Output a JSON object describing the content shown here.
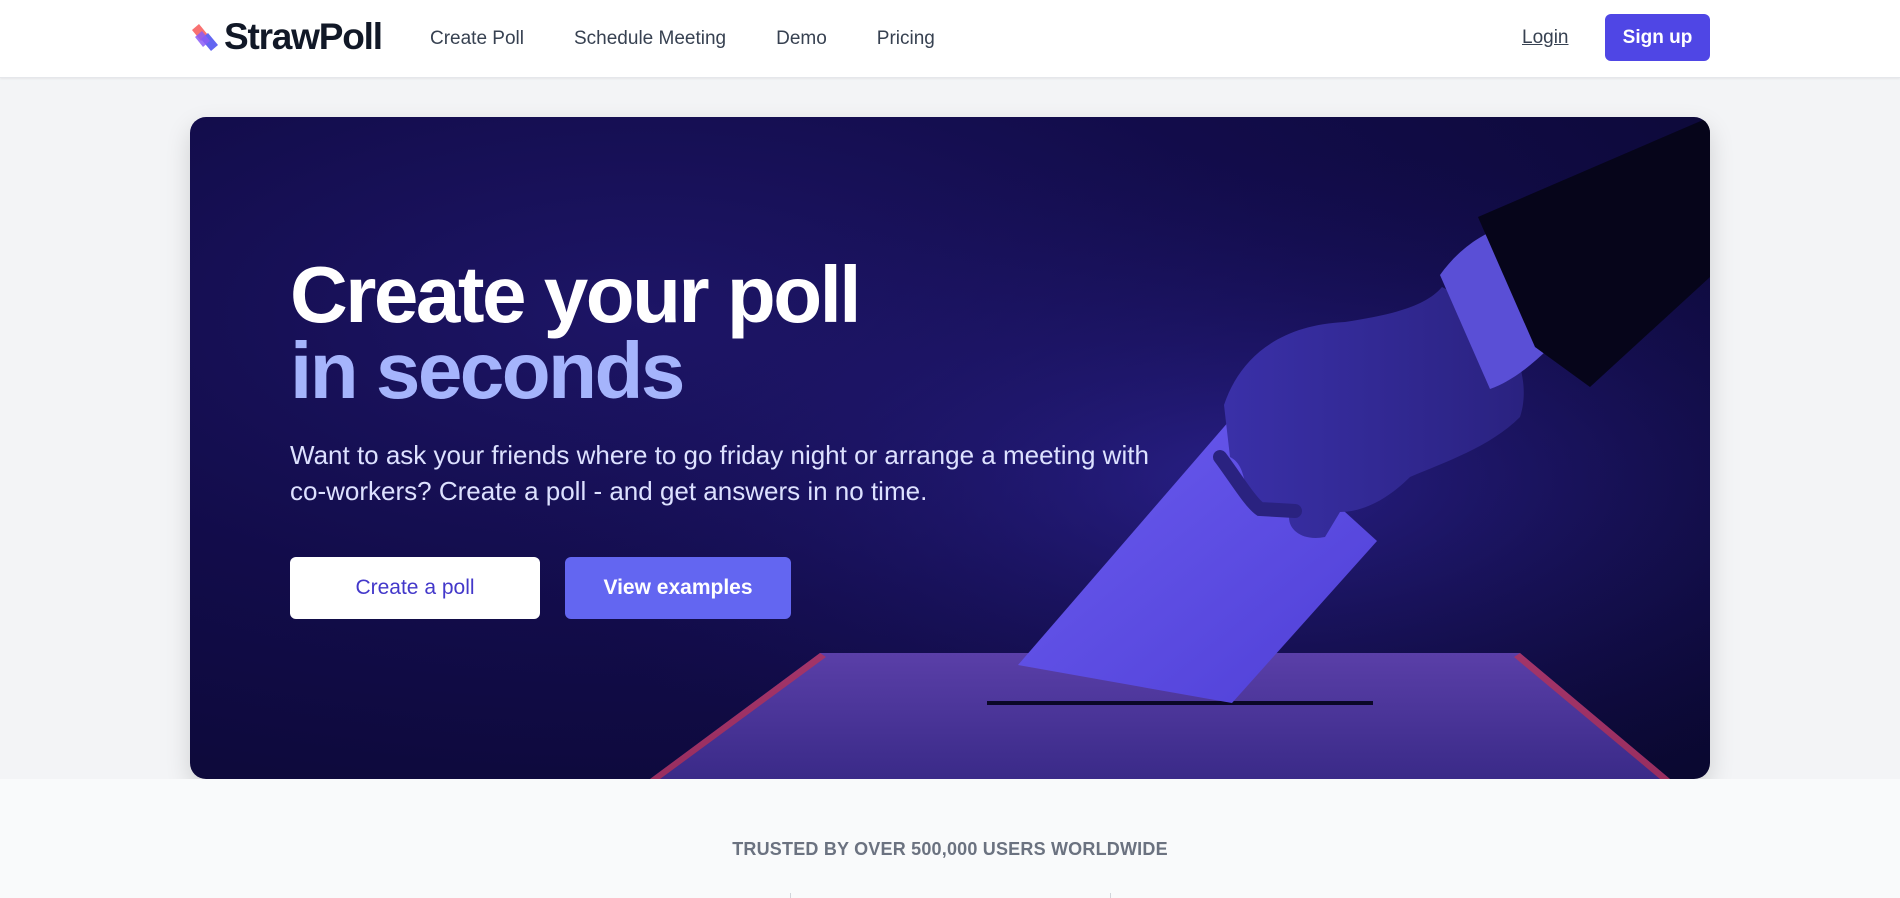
{
  "brand": {
    "name": "StrawPoll"
  },
  "nav": {
    "items": [
      {
        "label": "Create Poll"
      },
      {
        "label": "Schedule Meeting"
      },
      {
        "label": "Demo"
      },
      {
        "label": "Pricing"
      }
    ],
    "login_label": "Login",
    "signup_label": "Sign up"
  },
  "hero": {
    "headline_line1": "Create your poll",
    "headline_line2": "in seconds",
    "subtext": "Want to ask your friends where to go friday night or arrange a meeting with co-workers? Create a poll - and get answers in no time.",
    "primary_cta": "Create a poll",
    "secondary_cta": "View examples",
    "image_icon": "hand-casting-ballot-into-box"
  },
  "trusted": {
    "text": "TRUSTED BY OVER 500,000 USERS WORLDWIDE"
  },
  "colors": {
    "accent": "#4f46e5",
    "accent_light": "#6366f1",
    "headline_highlight": "#a5b4fc",
    "hero_bg": "#120c4a",
    "logo_red": "#f87171",
    "logo_indigo": "#6366f1"
  }
}
